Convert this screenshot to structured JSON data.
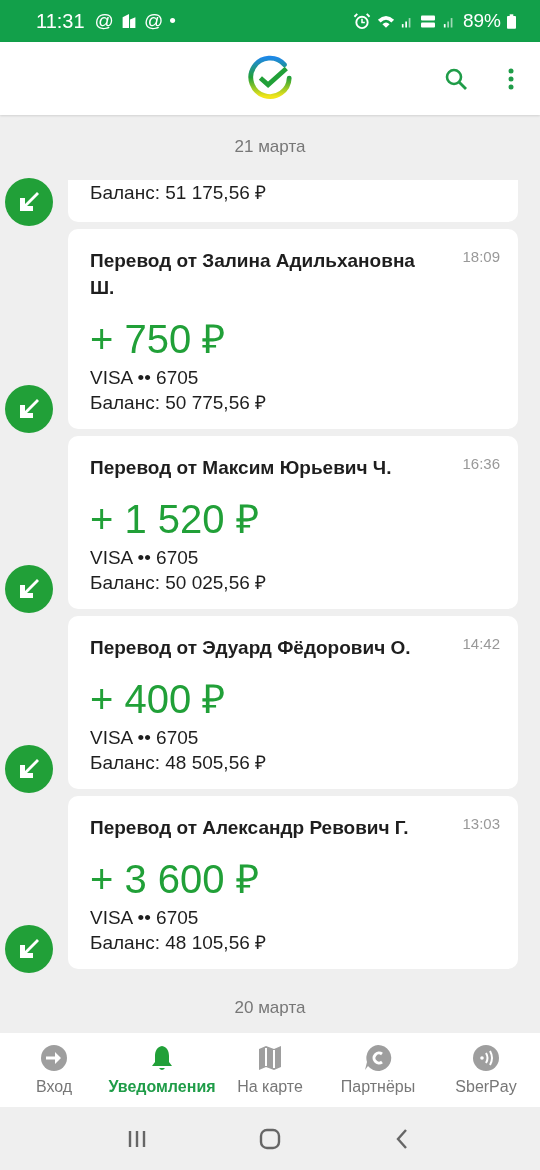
{
  "status_bar": {
    "time": "11:31",
    "notifications": [
      {
        "kind": "text",
        "text": "@"
      },
      {
        "kind": "icon"
      },
      {
        "kind": "text",
        "text": "@"
      },
      {
        "kind": "text",
        "text": "•"
      }
    ],
    "battery": "89%"
  },
  "sections": [
    {
      "date": "21 марта",
      "transactions": [
        {
          "kind": "partial",
          "balance": "Баланс: 51 175,56 ₽"
        },
        {
          "kind": "full",
          "title": "Перевод от Залина Адильхановна Ш.",
          "time": "18:09",
          "amount": "+ 750 ₽",
          "card": "VISA •• 6705",
          "balance": "Баланс: 50 775,56 ₽"
        },
        {
          "kind": "full",
          "title": "Перевод от Максим Юрьевич Ч.",
          "time": "16:36",
          "amount": "+ 1 520 ₽",
          "card": "VISA •• 6705",
          "balance": "Баланс: 50 025,56 ₽"
        },
        {
          "kind": "full",
          "title": "Перевод от Эдуард Фёдорович О.",
          "time": "14:42",
          "amount": "+ 400 ₽",
          "card": "VISA •• 6705",
          "balance": "Баланс: 48 505,56 ₽"
        },
        {
          "kind": "full",
          "title": "Перевод от Александр Ревович Г.",
          "time": "13:03",
          "amount": "+ 3 600 ₽",
          "card": "VISA •• 6705",
          "balance": "Баланс: 48 105,56 ₽"
        }
      ]
    },
    {
      "date": "20 марта"
    }
  ],
  "bottom_nav": [
    {
      "label": "Вход",
      "selected": false
    },
    {
      "label": "Уведомления",
      "selected": true
    },
    {
      "label": "На карте",
      "selected": false
    },
    {
      "label": "Партнёры",
      "selected": false
    },
    {
      "label": "SberPay",
      "selected": false
    }
  ]
}
